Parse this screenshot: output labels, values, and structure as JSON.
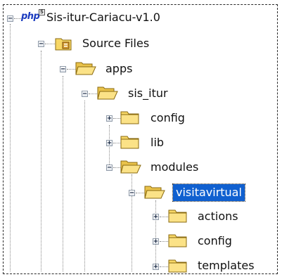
{
  "tree": {
    "project": {
      "name": "Sis-itur-Cariacu-v1.0",
      "icon": "php-project-icon",
      "badge_text": "php",
      "badge_small": "S"
    },
    "nodes": [
      {
        "label": "Source Files",
        "icon": "source-files-folder-icon",
        "toggle": "−"
      },
      {
        "label": "apps",
        "icon": "open-folder-icon",
        "toggle": "−"
      },
      {
        "label": "sis_itur",
        "icon": "open-folder-icon",
        "toggle": "−"
      },
      {
        "label": "config",
        "icon": "closed-folder-icon",
        "toggle": "+"
      },
      {
        "label": "lib",
        "icon": "closed-folder-icon",
        "toggle": "+"
      },
      {
        "label": "modules",
        "icon": "open-folder-icon",
        "toggle": "−"
      },
      {
        "label": "visitavirtual",
        "icon": "open-folder-icon",
        "toggle": "−",
        "selected": true
      },
      {
        "label": "actions",
        "icon": "closed-folder-icon",
        "toggle": "+"
      },
      {
        "label": "config",
        "icon": "closed-folder-icon",
        "toggle": "+"
      },
      {
        "label": "templates",
        "icon": "closed-folder-icon",
        "toggle": "+"
      }
    ]
  },
  "colors": {
    "selection": "#1060d0",
    "folder": "#f7d766",
    "php_badge": "#1a3bbf"
  }
}
